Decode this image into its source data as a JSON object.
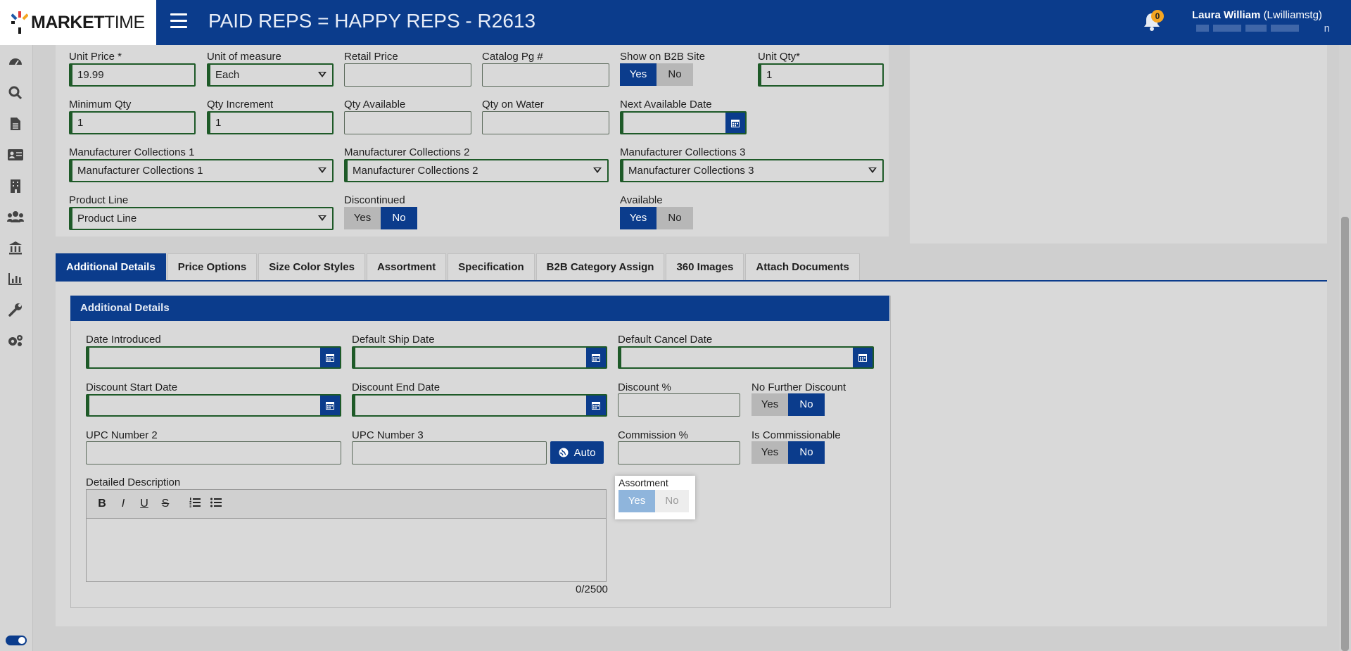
{
  "header": {
    "logo_bold": "MARKET",
    "logo_light": "TIME",
    "title": "PAID REPS = HAPPY REPS - R2613",
    "notification_count": "0",
    "user_name": "Laura William",
    "user_login": "(Lwilliamstg)",
    "user_sub_tail": "n"
  },
  "sidebar": {
    "icons": [
      "dashboard-icon",
      "search-icon",
      "document-icon",
      "contact-card-icon",
      "building-icon",
      "users-icon",
      "bank-icon",
      "chart-icon",
      "wrench-icon",
      "gears-icon"
    ]
  },
  "product": {
    "unit_price_label": "Unit Price *",
    "unit_price_value": "19.99",
    "uom_label": "Unit of measure",
    "uom_value": "Each",
    "retail_price_label": "Retail Price",
    "catalog_pg_label": "Catalog Pg #",
    "show_b2b_label": "Show on B2B Site",
    "unit_qty_label": "Unit Qty*",
    "unit_qty_value": "1",
    "min_qty_label": "Minimum Qty",
    "min_qty_value": "1",
    "qty_increment_label": "Qty Increment",
    "qty_increment_value": "1",
    "qty_available_label": "Qty Available",
    "qty_on_water_label": "Qty on Water",
    "next_available_label": "Next Available Date",
    "mc1_label": "Manufacturer Collections 1",
    "mc1_value": "Manufacturer Collections 1",
    "mc2_label": "Manufacturer Collections 2",
    "mc2_value": "Manufacturer Collections 2",
    "mc3_label": "Manufacturer Collections 3",
    "mc3_value": "Manufacturer Collections 3",
    "product_line_label": "Product Line",
    "product_line_value": "Product Line",
    "discontinued_label": "Discontinued",
    "available_label": "Available",
    "yes": "Yes",
    "no": "No",
    "show_b2b_selected": "Yes",
    "discontinued_selected": "No",
    "available_selected": "Yes"
  },
  "tabs": [
    "Additional Details",
    "Price Options",
    "Size Color Styles",
    "Assortment",
    "Specification",
    "B2B Category Assign",
    "360 Images",
    "Attach Documents"
  ],
  "additional": {
    "section_title": "Additional Details",
    "date_introduced_label": "Date Introduced",
    "default_ship_label": "Default Ship Date",
    "default_cancel_label": "Default Cancel Date",
    "discount_start_label": "Discount Start Date",
    "discount_end_label": "Discount End Date",
    "discount_pct_label": "Discount %",
    "no_further_discount_label": "No Further Discount",
    "upc2_label": "UPC Number 2",
    "upc3_label": "UPC Number 3",
    "auto_button": "Auto",
    "commission_pct_label": "Commission %",
    "is_commissionable_label": "Is Commissionable",
    "detailed_desc_label": "Detailed Description",
    "char_count": "0/2500",
    "assortment_label": "Assortment",
    "no_further_discount_selected": "No",
    "is_commissionable_selected": "No",
    "assortment_selected": "Yes"
  },
  "editor_toolbar": [
    "B",
    "I",
    "U",
    "S"
  ],
  "colors": {
    "primary": "#0b3c8c",
    "required_border": "#1e5a28",
    "badge": "#f5a623"
  }
}
